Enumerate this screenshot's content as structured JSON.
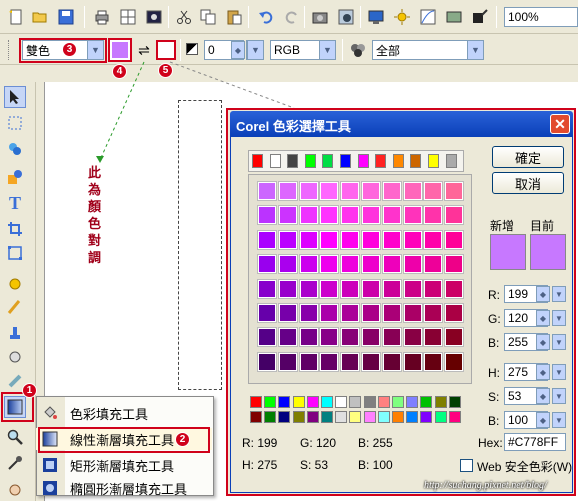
{
  "toolbar1": {
    "zoom": "100%"
  },
  "toolbar2": {
    "fill_mode": "雙色",
    "opacity_value": "0",
    "color_model": "RGB",
    "channel": "全部"
  },
  "badges": {
    "b1": "1",
    "b2": "2",
    "b3": "3",
    "b4": "4",
    "b5": "5"
  },
  "annotation": "此\n為\n顏\n色\n對\n調",
  "fill_menu": {
    "items": [
      {
        "label": "色彩填充工具"
      },
      {
        "label": "線性漸層填充工具"
      },
      {
        "label": "矩形漸層填充工具"
      },
      {
        "label": "橢圓形漸層填充工具"
      }
    ]
  },
  "dialog": {
    "title": "Corel 色彩選擇工具",
    "ok": "確定",
    "cancel": "取消",
    "new_label": "新增",
    "current_label": "目前",
    "new_color": "#C778FF",
    "current_color": "#C778FF",
    "r_label": "R:",
    "r_value": "199",
    "g_label": "G:",
    "g_value": "120",
    "b_label": "B:",
    "b_value": "255",
    "h_label": "H:",
    "h_value": "275",
    "s_label": "S:",
    "s_value": "53",
    "bv_label": "B:",
    "bv_value": "100",
    "hex_label": "Hex:",
    "hex_value": "#C778FF",
    "readout_r": "R: 199",
    "readout_g": "G: 120",
    "readout_b": "B: 255",
    "readout_h": "H: 275",
    "readout_s": "S: 53",
    "readout_bv": "B: 100",
    "websafe": "Web 安全色彩(W)",
    "palette_tabs": [
      "#ff0000",
      "#ffffff",
      "#444444",
      "#00ff00",
      "#00dd44",
      "#0000ff",
      "#ff00ff",
      "#ff2222",
      "#ff8800",
      "#cc6600",
      "#ffff00",
      "#aaaaaa"
    ],
    "grid_colors": [
      [
        "#cc66ff",
        "#dd66ff",
        "#ee66ff",
        "#ff66ff",
        "#ff66ee",
        "#ff66dd",
        "#ff66cc",
        "#ff66bb",
        "#ff66aa",
        "#ff6699"
      ],
      [
        "#bb33ff",
        "#cc33ff",
        "#ee33ff",
        "#ff33ff",
        "#ff33ee",
        "#ff33dd",
        "#ff33cc",
        "#ff33bb",
        "#ff33aa",
        "#ff3399"
      ],
      [
        "#aa00ff",
        "#bb00ff",
        "#dd00ff",
        "#ff00ff",
        "#ff00ee",
        "#ff00dd",
        "#ff00cc",
        "#ff00bb",
        "#ff00aa",
        "#ff0099"
      ],
      [
        "#9900ee",
        "#aa00ee",
        "#cc00ee",
        "#ee00ee",
        "#ee00dd",
        "#ee00cc",
        "#ee00bb",
        "#ee00aa",
        "#ee0099",
        "#ee0088"
      ],
      [
        "#8800cc",
        "#9900cc",
        "#aa00cc",
        "#cc00cc",
        "#cc00bb",
        "#cc00aa",
        "#cc0099",
        "#cc0088",
        "#cc0077",
        "#cc0066"
      ],
      [
        "#6600aa",
        "#7700aa",
        "#8800aa",
        "#aa00aa",
        "#aa0099",
        "#aa0088",
        "#aa0077",
        "#aa0066",
        "#aa0055",
        "#aa0044"
      ],
      [
        "#550088",
        "#660088",
        "#770088",
        "#880088",
        "#880077",
        "#880066",
        "#880055",
        "#880044",
        "#880033",
        "#880022"
      ],
      [
        "#440066",
        "#550066",
        "#600066",
        "#660066",
        "#660055",
        "#660044",
        "#660033",
        "#660022",
        "#660011",
        "#660000"
      ]
    ],
    "bottom_palette": [
      [
        "#ff0000",
        "#00ff00",
        "#0000ff",
        "#ffff00",
        "#ff00ff",
        "#00ffff",
        "#ffffff",
        "#c0c0c0",
        "#808080",
        "#ff8080",
        "#80ff80",
        "#8080ff",
        "#00c000",
        "#808000",
        "#004000"
      ],
      [
        "#800000",
        "#008000",
        "#000080",
        "#808000",
        "#800080",
        "#008080",
        "#e0e0e0",
        "#ffff80",
        "#ff80ff",
        "#80ffff",
        "#ff8000",
        "#0080ff",
        "#8000ff",
        "#00ff80",
        "#ff0080"
      ]
    ]
  },
  "watermark": "http://suchang.pixnet.net/blog/"
}
